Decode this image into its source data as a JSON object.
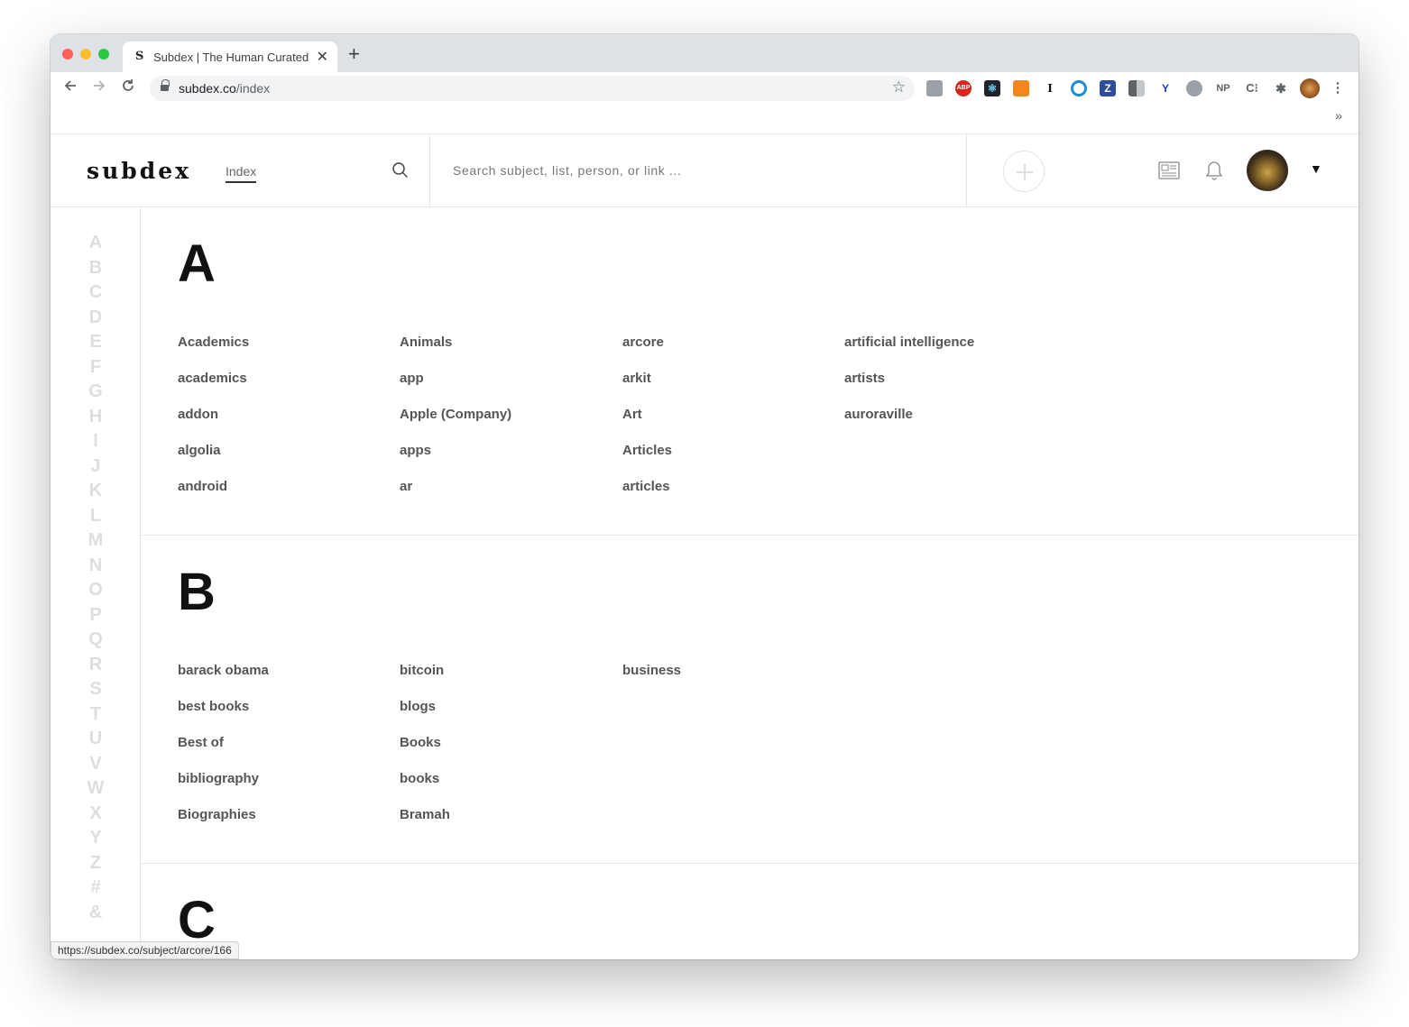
{
  "browser": {
    "tab_title": "Subdex | The Human Curated Index",
    "tab_favicon": "S",
    "new_tab": "+",
    "url_host": "subdex.co",
    "url_path": "/index",
    "extensions": [
      "briefcase-icon",
      "adblock-icon",
      "react-devtools-icon",
      "metamask-icon",
      "instapaper-icon",
      "cursor-icon",
      "zotero-icon",
      "sidebar-icon",
      "yoroi-icon",
      "discord-icon",
      "np-icon",
      "css-icon",
      "puzzle-icon",
      "profile-icon"
    ],
    "ext_labels": {
      "abp": "ABP",
      "instapaper": "I",
      "zotero": "Z",
      "np": "NP",
      "css": "C⁝"
    },
    "bookmarks_chevron": "»",
    "status_url": "https://subdex.co/subject/arcore/166"
  },
  "header": {
    "logo": "subdex",
    "nav_index": "Index",
    "search_placeholder": "Search subject, list, person, or link ...",
    "dropdown": "▼"
  },
  "alphabet": [
    "A",
    "B",
    "C",
    "D",
    "E",
    "F",
    "G",
    "H",
    "I",
    "J",
    "K",
    "L",
    "M",
    "N",
    "O",
    "P",
    "Q",
    "R",
    "S",
    "T",
    "U",
    "V",
    "W",
    "X",
    "Y",
    "Z",
    "#",
    "&"
  ],
  "sections": {
    "a": {
      "letter": "A",
      "columns": [
        [
          "Academics",
          "academics",
          "addon",
          "algolia",
          "android"
        ],
        [
          "Animals",
          "app",
          "Apple (Company)",
          "apps",
          "ar"
        ],
        [
          "arcore",
          "arkit",
          "Art",
          "Articles",
          "articles"
        ],
        [
          "artificial intelligence",
          "artists",
          "auroraville"
        ]
      ]
    },
    "b": {
      "letter": "B",
      "columns": [
        [
          "barack obama",
          "best books",
          "Best of",
          "bibliography",
          "Biographies"
        ],
        [
          "bitcoin",
          "blogs",
          "Books",
          "books",
          "Bramah"
        ],
        [
          "business"
        ]
      ]
    },
    "c": {
      "letter": "C"
    }
  }
}
